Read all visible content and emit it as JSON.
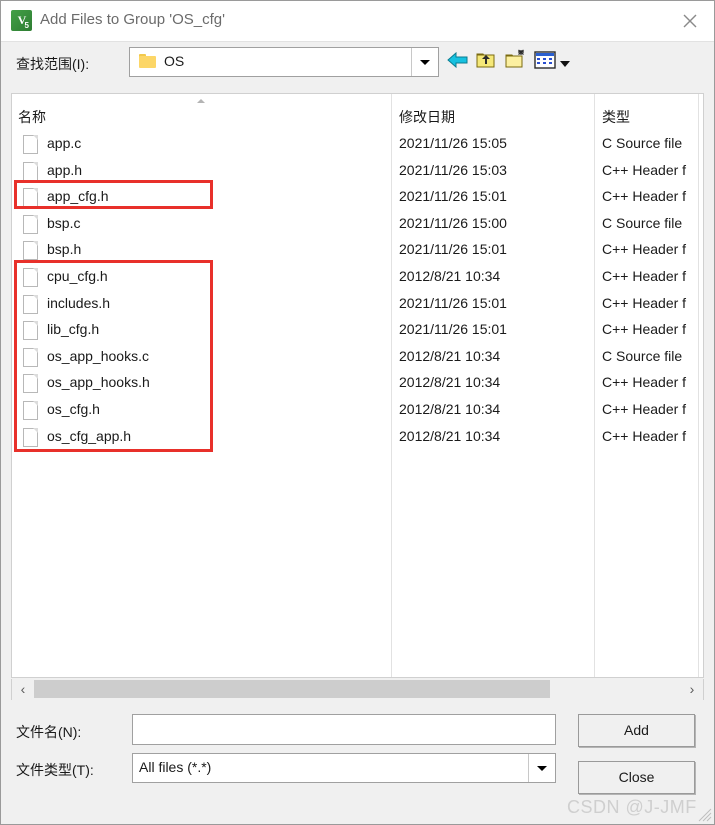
{
  "window": {
    "title": "Add Files to Group 'OS_cfg'",
    "app_icon": "uvision-icon",
    "icon_glyph": "V",
    "icon_sub": "5",
    "close_label": "×"
  },
  "toolbar": {
    "lookin_label": "查找范围(I):",
    "current_folder": "OS",
    "back_icon": "back-arrow-icon",
    "up_icon": "up-one-level-icon",
    "newfolder_icon": "new-folder-icon",
    "views_icon": "views-icon"
  },
  "filelist": {
    "columns": [
      "名称",
      "修改日期",
      "类型"
    ],
    "sort_indicator": "ascending",
    "rows": [
      {
        "name": "app.c",
        "date": "2021/11/26 15:05",
        "type": "C Source file"
      },
      {
        "name": "app.h",
        "date": "2021/11/26 15:03",
        "type": "C++ Header f"
      },
      {
        "name": "app_cfg.h",
        "date": "2021/11/26 15:01",
        "type": "C++ Header f"
      },
      {
        "name": "bsp.c",
        "date": "2021/11/26 15:00",
        "type": "C Source file"
      },
      {
        "name": "bsp.h",
        "date": "2021/11/26 15:01",
        "type": "C++ Header f"
      },
      {
        "name": "cpu_cfg.h",
        "date": "2012/8/21 10:34",
        "type": "C++ Header f"
      },
      {
        "name": "includes.h",
        "date": "2021/11/26 15:01",
        "type": "C++ Header f"
      },
      {
        "name": "lib_cfg.h",
        "date": "2021/11/26 15:01",
        "type": "C++ Header f"
      },
      {
        "name": "os_app_hooks.c",
        "date": "2012/8/21 10:34",
        "type": "C Source file"
      },
      {
        "name": "os_app_hooks.h",
        "date": "2012/8/21 10:34",
        "type": "C++ Header f"
      },
      {
        "name": "os_cfg.h",
        "date": "2012/8/21 10:34",
        "type": "C++ Header f"
      },
      {
        "name": "os_cfg_app.h",
        "date": "2012/8/21 10:34",
        "type": "C++ Header f"
      }
    ]
  },
  "annotations": {
    "color": "#e8302a",
    "boxes": [
      {
        "label": "highlight-app-cfg"
      },
      {
        "label": "highlight-os-config-files"
      }
    ]
  },
  "scrollbar": {
    "left_chevron": "‹",
    "right_chevron": "›"
  },
  "bottom": {
    "filename_label": "文件名(N):",
    "filename_value": "",
    "filename_placeholder": "",
    "filetype_label": "文件类型(T):",
    "filetype_value": "All files (*.*)",
    "add_label": "Add",
    "close_label": "Close"
  },
  "watermark": {
    "text": "CSDN @J-JMF"
  }
}
